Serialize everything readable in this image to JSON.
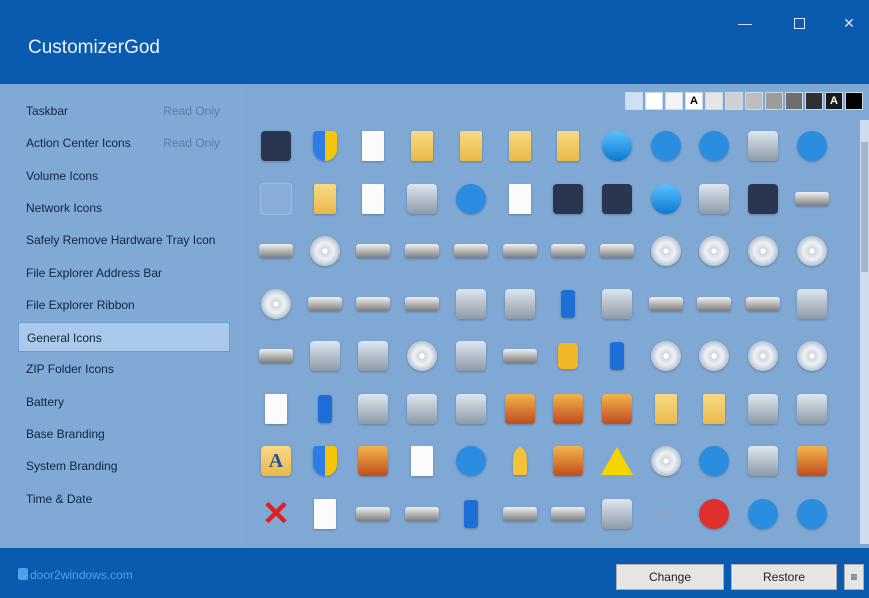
{
  "app": {
    "title": "CustomizerGod"
  },
  "window": {
    "minimize": "—",
    "close": "✕"
  },
  "sidebar": {
    "items": [
      {
        "label": "Taskbar",
        "tag": "Read Only"
      },
      {
        "label": "Action Center Icons",
        "tag": "Read Only"
      },
      {
        "label": "Volume Icons",
        "tag": ""
      },
      {
        "label": "Network Icons",
        "tag": ""
      },
      {
        "label": "Safely Remove Hardware Tray Icon",
        "tag": ""
      },
      {
        "label": "File Explorer Address Bar",
        "tag": ""
      },
      {
        "label": "File Explorer Ribbon",
        "tag": ""
      },
      {
        "label": "General Icons",
        "tag": "",
        "active": true
      },
      {
        "label": "ZIP Folder Icons",
        "tag": ""
      },
      {
        "label": "Battery",
        "tag": ""
      },
      {
        "label": "Base Branding",
        "tag": ""
      },
      {
        "label": "System Branding",
        "tag": ""
      },
      {
        "label": "Time & Date",
        "tag": ""
      }
    ]
  },
  "swatches": {
    "letter_light": "A",
    "letter_dark": "A"
  },
  "icons": [
    [
      "monitor",
      "shield",
      "doc",
      "folder",
      "folder",
      "folder",
      "folder",
      "search",
      "folder-blue",
      "folder-blue",
      "fan",
      "window"
    ],
    [
      "blank",
      "folder",
      "doc",
      "mail",
      "window",
      "doc",
      "film",
      "monitor",
      "globe",
      "printer",
      "monitor",
      "drive"
    ],
    [
      "drive",
      "disc",
      "drive-x",
      "drive",
      "drive",
      "drive",
      "drive",
      "drive",
      "disc",
      "disc",
      "disc",
      "disc"
    ],
    [
      "disc",
      "drive",
      "drive",
      "drive",
      "printer",
      "camera",
      "phone",
      "printer",
      "drive",
      "drive",
      "drive",
      "printer"
    ],
    [
      "drive",
      "recycle",
      "recycle",
      "disc",
      "camera",
      "drive",
      "lock",
      "phone",
      "disc",
      "disc",
      "disc",
      "disc"
    ],
    [
      "doc",
      "phone",
      "gear",
      "gear",
      "gear",
      "pic",
      "pic",
      "pic",
      "folder",
      "folder",
      "help",
      "printer"
    ],
    [
      "letterA",
      "shield",
      "users",
      "doc",
      "info",
      "key",
      "pic",
      "warn",
      "disc",
      "power",
      "camera",
      "users"
    ],
    [
      "x",
      "doc",
      "drive",
      "drive",
      "phone",
      "drive",
      "drive",
      "dark",
      "smallx",
      "red",
      "blue",
      "window"
    ]
  ],
  "footer": {
    "brand": "door2windows.com",
    "change_label": "Change",
    "restore_label": "Restore",
    "menu_label": "≡"
  },
  "colors": {
    "accent": "#0a5bb0",
    "panel": "#7fa8d4"
  }
}
